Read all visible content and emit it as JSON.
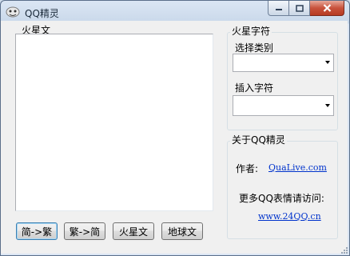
{
  "window": {
    "title": "QQ精灵"
  },
  "martian": {
    "group_label": "火星文",
    "text_value": ""
  },
  "insert_group": {
    "label": "火星字符",
    "category_label": "选择类别",
    "category_value": "",
    "insert_label": "插入字符",
    "insert_value": ""
  },
  "about": {
    "label": "关于QQ精灵",
    "author_label": "作者:",
    "author_link": "QuaLive.com",
    "more_text": "更多QQ表情请访问:",
    "site_link": "www.24QQ.cn"
  },
  "buttons": {
    "simp_to_trad": "简->繁",
    "trad_to_simp": "繁->简",
    "to_martian": "火星文",
    "to_earth": "地球文"
  }
}
